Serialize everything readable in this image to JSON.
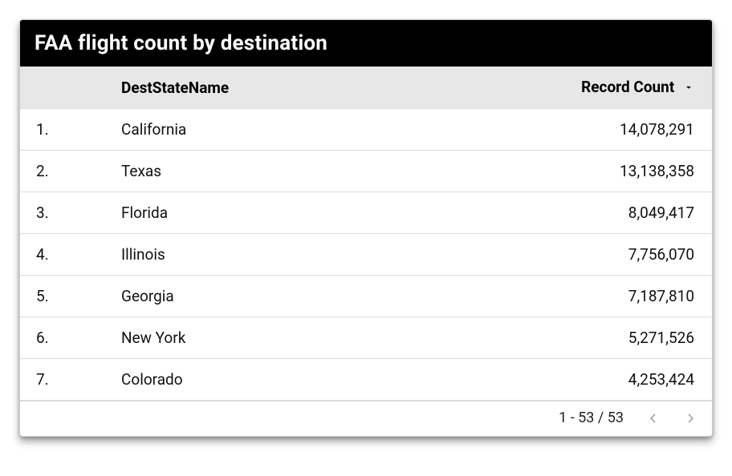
{
  "card": {
    "title": "FAA flight count by destination"
  },
  "columns": {
    "index_header": "",
    "state_header": "DestStateName",
    "count_header": "Record Count",
    "sort": "desc"
  },
  "rows": [
    {
      "rank": "1.",
      "state": "California",
      "count": "14,078,291"
    },
    {
      "rank": "2.",
      "state": "Texas",
      "count": "13,138,358"
    },
    {
      "rank": "3.",
      "state": "Florida",
      "count": "8,049,417"
    },
    {
      "rank": "4.",
      "state": "Illinois",
      "count": "7,756,070"
    },
    {
      "rank": "5.",
      "state": "Georgia",
      "count": "7,187,810"
    },
    {
      "rank": "6.",
      "state": "New York",
      "count": "5,271,526"
    },
    {
      "rank": "7.",
      "state": "Colorado",
      "count": "4,253,424"
    }
  ],
  "pagination": {
    "range_text": "1 - 53 / 53"
  },
  "chart_data": {
    "type": "table",
    "title": "FAA flight count by destination",
    "columns": [
      "DestStateName",
      "Record Count"
    ],
    "sort": {
      "column": "Record Count",
      "direction": "desc"
    },
    "total_rows": 53,
    "visible_range": [
      1,
      7
    ],
    "rows": [
      {
        "DestStateName": "California",
        "Record Count": 14078291
      },
      {
        "DestStateName": "Texas",
        "Record Count": 13138358
      },
      {
        "DestStateName": "Florida",
        "Record Count": 8049417
      },
      {
        "DestStateName": "Illinois",
        "Record Count": 7756070
      },
      {
        "DestStateName": "Georgia",
        "Record Count": 7187810
      },
      {
        "DestStateName": "New York",
        "Record Count": 5271526
      },
      {
        "DestStateName": "Colorado",
        "Record Count": 4253424
      }
    ]
  }
}
